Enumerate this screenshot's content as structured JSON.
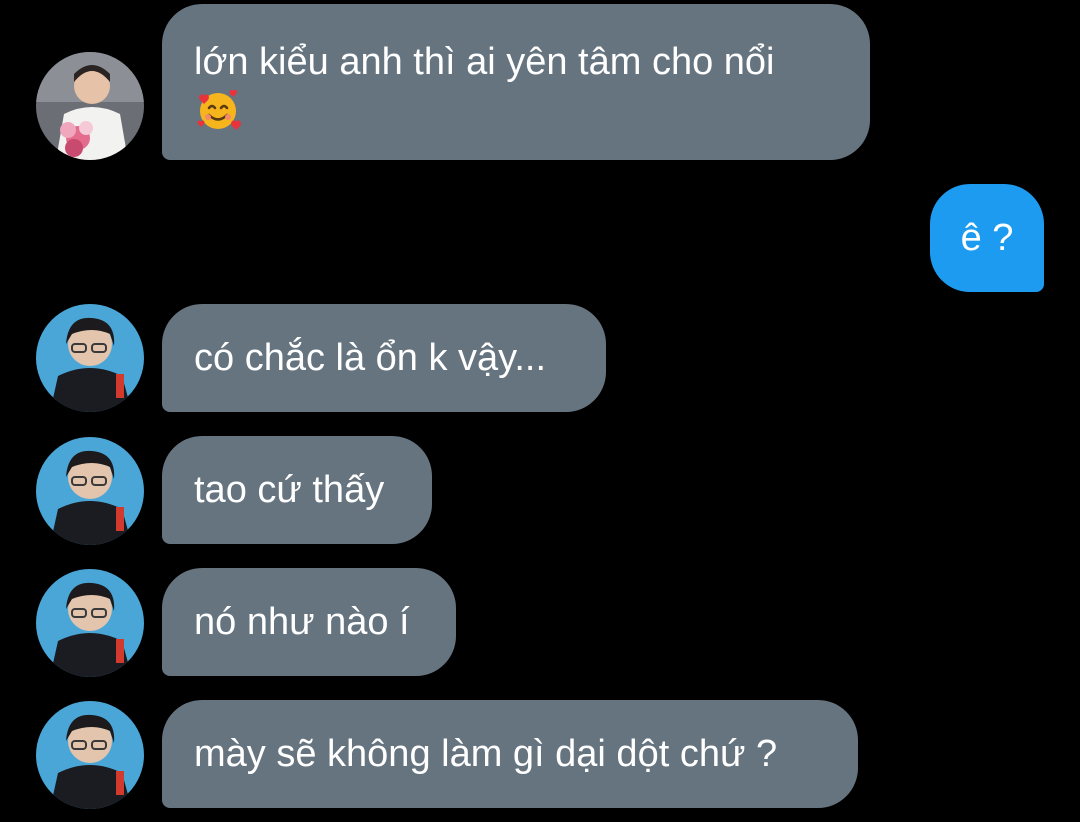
{
  "thread": {
    "messages": [
      {
        "side": "incoming",
        "text": "lớn kiểu anh thì ai yên tâm cho nổi",
        "emoji": "smiling-face-with-hearts"
      },
      {
        "side": "outgoing",
        "text": "ê ?"
      },
      {
        "side": "incoming",
        "text": "có chắc là ổn k vậy..."
      },
      {
        "side": "incoming",
        "text": "tao cứ thấy"
      },
      {
        "side": "incoming",
        "text": "nó như nào í"
      },
      {
        "side": "incoming",
        "text": "mày sẽ không làm gì dại dột chứ ?"
      }
    ]
  },
  "colors": {
    "background": "#000000",
    "incoming_bubble": "#66747f",
    "outgoing_bubble": "#1d9bf0",
    "text": "#ffffff"
  }
}
